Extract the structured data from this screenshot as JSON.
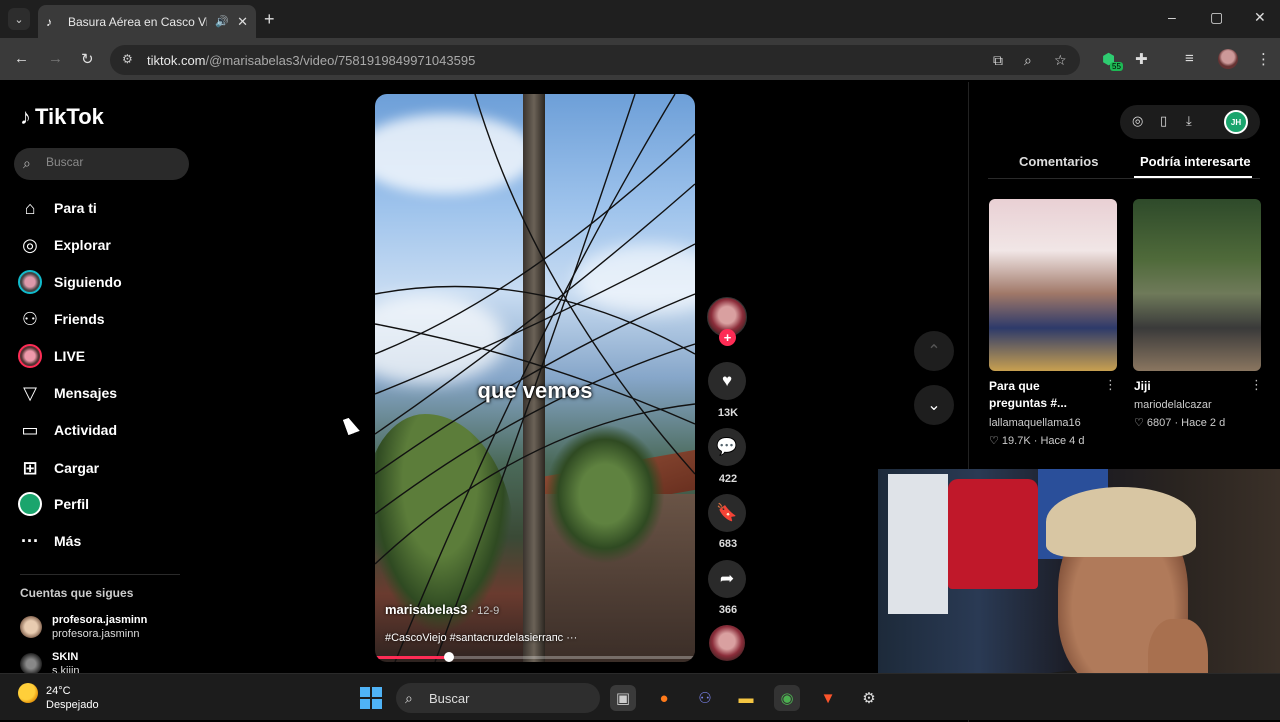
{
  "browser": {
    "tab_title": "Basura Aérea en Casco Viejo",
    "tab_close": "✕",
    "new_tab": "+",
    "url_host": "tiktok.com",
    "url_path": "/@marisabelas3/video/7581919849971043595",
    "extension_badge": "55",
    "window_controls": [
      "–",
      "▢",
      "✕"
    ]
  },
  "sidebar": {
    "logo": "TikTok",
    "search_placeholder": "Buscar",
    "items": [
      {
        "label": "Para ti",
        "icon": "home-icon"
      },
      {
        "label": "Explorar",
        "icon": "compass-icon"
      },
      {
        "label": "Siguiendo",
        "icon": "following-avatar"
      },
      {
        "label": "Friends",
        "icon": "friends-icon"
      },
      {
        "label": "LIVE",
        "icon": "live-avatar"
      },
      {
        "label": "Mensajes",
        "icon": "send-icon"
      },
      {
        "label": "Actividad",
        "icon": "activity-icon"
      },
      {
        "label": "Cargar",
        "icon": "upload-icon"
      },
      {
        "label": "Perfil",
        "icon": "profile-avatar"
      },
      {
        "label": "Más",
        "icon": "more-icon"
      }
    ],
    "following_heading": "Cuentas que sigues",
    "accounts": [
      {
        "username": "profesora.jasminn",
        "name": "profesora.jasminn"
      },
      {
        "username": "SKIN",
        "name": "s.kiiin"
      }
    ]
  },
  "video": {
    "caption": "que vemos",
    "author": "marisabelas3",
    "date": " · 12-9",
    "tags": "#CascoViejo #santacruzdelasierraпс ···",
    "progress": 0.23
  },
  "actions": {
    "likes": "13K",
    "comments": "422",
    "saves": "683",
    "shares": "366"
  },
  "right_panel": {
    "tabs": [
      "Comentarios",
      "Podría interesarte"
    ],
    "videos": [
      {
        "title_line1": "Para que",
        "title_line2": "preguntas #...",
        "author": "lallamaquellama16",
        "meta": "♡ 19.7K · Hace 4 d"
      },
      {
        "title_line1": "Jiji",
        "title_line2": "",
        "author": "mariodelalcazar",
        "meta": "♡ 6807 · Hace 2 d"
      }
    ],
    "profile_initials": "JH"
  },
  "taskbar": {
    "temp": "24°C",
    "weather": "Despejado",
    "search_label": "Buscar"
  },
  "colors": {
    "accent": "#fe2c55",
    "background": "#000000"
  }
}
